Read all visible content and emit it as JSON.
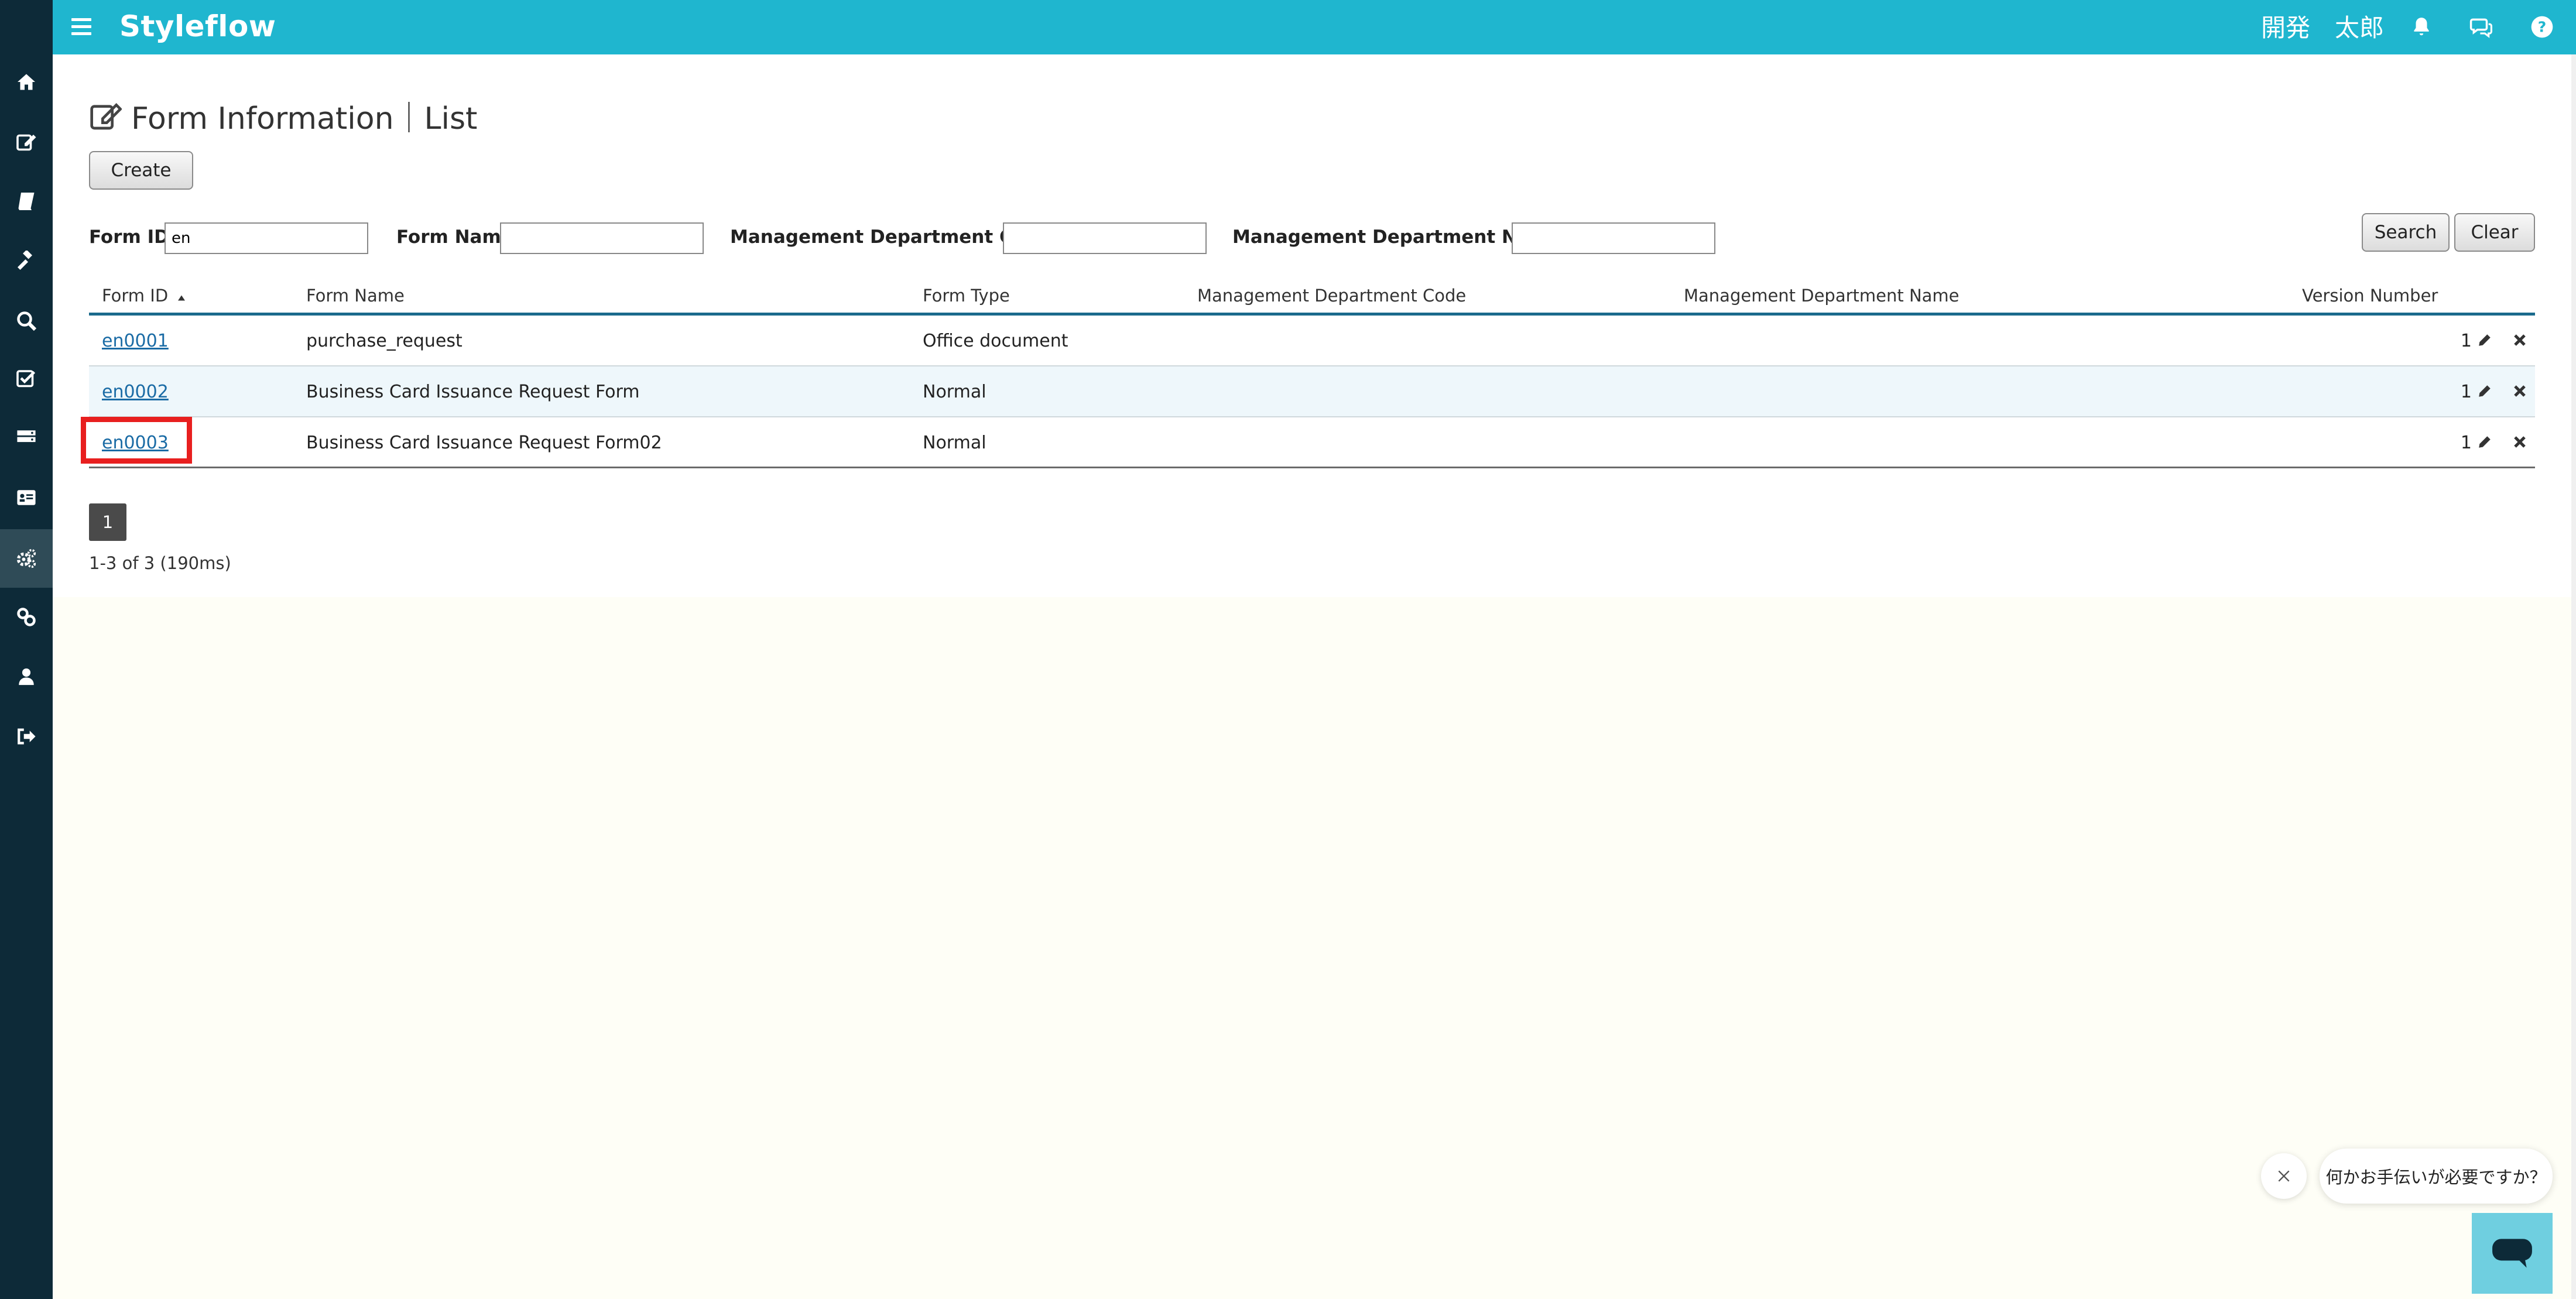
{
  "header": {
    "brand": "Styleflow",
    "user_name": "開発　太郎",
    "icons": [
      "menu-icon",
      "bell-icon",
      "chat-icon",
      "help-icon"
    ]
  },
  "sidebar": {
    "items": [
      {
        "icon": "home-icon"
      },
      {
        "icon": "edit-icon"
      },
      {
        "icon": "book-icon"
      },
      {
        "icon": "gavel-icon"
      },
      {
        "icon": "search-icon"
      },
      {
        "icon": "check-square-icon"
      },
      {
        "icon": "server-icon"
      },
      {
        "icon": "id-card-icon"
      },
      {
        "icon": "cogs-icon",
        "active": true
      },
      {
        "icon": "link-icon"
      },
      {
        "icon": "user-icon"
      },
      {
        "icon": "sign-out-icon"
      }
    ]
  },
  "page": {
    "title": "Form Information｜List",
    "create_label": "Create"
  },
  "filters": {
    "form_id_label": "Form ID",
    "form_id_value": "en",
    "form_name_label": "Form Name",
    "form_name_value": "",
    "dept_code_label": "Management Department Code",
    "dept_code_value": "",
    "dept_name_label": "Management Department Name",
    "dept_name_value": "",
    "search_label": "Search",
    "clear_label": "Clear"
  },
  "table": {
    "columns": [
      "Form ID",
      "Form Name",
      "Form Type",
      "Management Department Code",
      "Management Department Name",
      "Version Number"
    ],
    "sort_column": "Form ID",
    "sort_direction": "ascending",
    "rows": [
      {
        "form_id": "en0001",
        "form_name": "purchase_request",
        "form_type": "Office document",
        "dept_code": "",
        "dept_name": "",
        "version": "1"
      },
      {
        "form_id": "en0002",
        "form_name": "Business Card Issuance Request Form",
        "form_type": "Normal",
        "dept_code": "",
        "dept_name": "",
        "version": "1"
      },
      {
        "form_id": "en0003",
        "form_name": "Business Card Issuance Request Form02",
        "form_type": "Normal",
        "dept_code": "",
        "dept_name": "",
        "version": "1"
      }
    ]
  },
  "pagination": {
    "current_page": "1",
    "summary": "1-3 of 3 (190ms)"
  },
  "chat": {
    "prompt": "何かお手伝いが必要ですか？"
  },
  "colors": {
    "header": "#1fb6cf",
    "sidebar": "#0d2a38",
    "link": "#1a6ba5",
    "highlight": "#e81f1f",
    "chat_button": "#6fcfe0"
  }
}
